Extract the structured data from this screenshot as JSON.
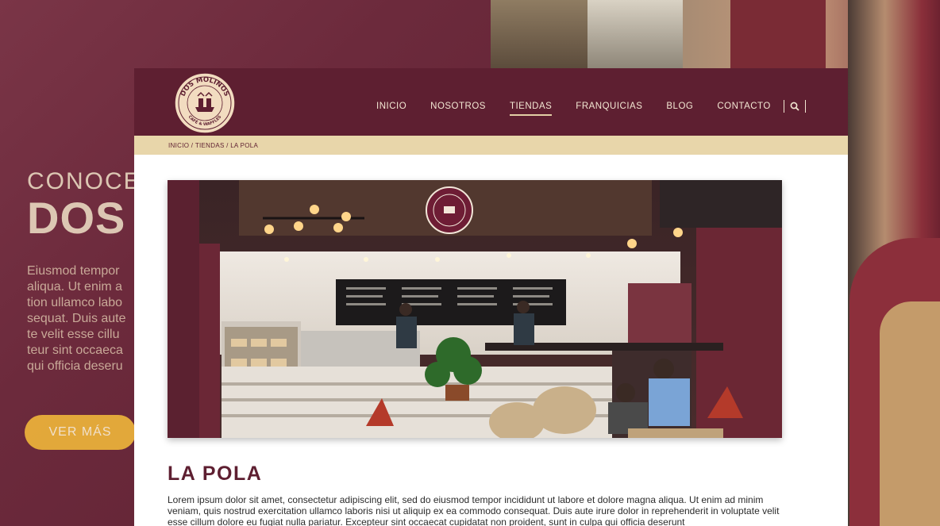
{
  "background": {
    "hero_line1": "CONOCE",
    "hero_line2": "DOS",
    "hero_text_lines": [
      "Eiusmod tempor",
      "aliqua. Ut enim a",
      "tion ullamco labo",
      "sequat. Duis aute",
      "te velit esse cillu",
      "teur sint occaeca",
      "qui officia deseru"
    ],
    "hero_button": "VER MÁS"
  },
  "header": {
    "logo_alt": "Dos Molinos Café & Waffles",
    "logo_text_top": "DOS MOLINOS",
    "logo_text_bottom": "CAFÉ & WAFFLES",
    "nav": [
      {
        "label": "INICIO",
        "active": false
      },
      {
        "label": "NOSOTROS",
        "active": false
      },
      {
        "label": "TIENDAS",
        "active": true
      },
      {
        "label": "FRANQUICIAS",
        "active": false
      },
      {
        "label": "BLOG",
        "active": false
      },
      {
        "label": "CONTACTO",
        "active": false
      }
    ],
    "search_icon": "search-icon"
  },
  "breadcrumb": {
    "items": [
      "INICIO",
      "TIENDAS",
      "LA POLA"
    ],
    "separator": " / "
  },
  "store": {
    "title": "LA POLA",
    "body": "Lorem ipsum dolor sit amet, consectetur adipiscing elit, sed do eiusmod tempor incididunt ut labore et dolore magna aliqua. Ut enim ad minim veniam, quis nostrud exercitation ullamco laboris nisi ut aliquip ex ea commodo consequat. Duis aute irure dolor in reprehenderit in voluptate velit esse cillum dolore eu fugiat nulla pariatur. Excepteur sint occaecat cupidatat non proident, sunt in culpa qui officia deserunt"
  },
  "colors": {
    "brand": "#5e1f31",
    "cream": "#e8d6aa",
    "button": "#f0b63a"
  }
}
